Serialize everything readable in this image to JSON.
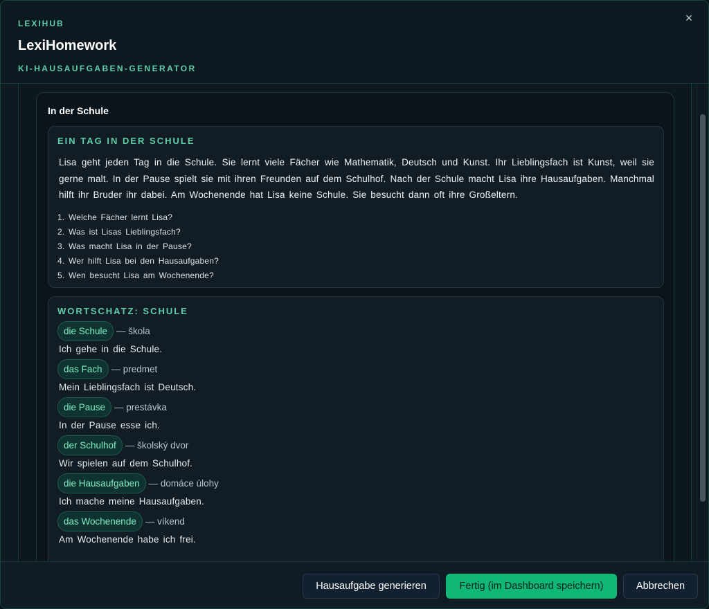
{
  "header": {
    "brand": "LEXIHUB",
    "title": "LexiHomework",
    "subtitle": "KI-HAUSAUFGABEN-GENERATOR",
    "close_label": "×"
  },
  "card": {
    "title": "In der Schule",
    "reading": {
      "heading": "EIN TAG IN DER SCHULE",
      "passage": "Lisa geht jeden Tag in die Schule. Sie lernt viele Fächer wie Mathematik, Deutsch und Kunst. Ihr Lieblingsfach ist Kunst, weil sie gerne malt. In der Pause spielt sie mit ihren Freunden auf dem Schulhof. Nach der Schule macht Lisa ihre Hausaufgaben. Manchmal hilft ihr Bruder ihr dabei. Am Wochenende hat Lisa keine Schule. Sie besucht dann oft ihre Großeltern.",
      "questions": [
        "1. Welche Fächer lernt Lisa?",
        "2. Was ist Lisas Lieblingsfach?",
        "3. Was macht Lisa in der Pause?",
        "4. Wer hilft Lisa bei den Hausaufgaben?",
        "5. Wen besucht Lisa am Wochenende?"
      ]
    },
    "vocab": {
      "heading": "WORTSCHATZ: SCHULE",
      "items": [
        {
          "term": "die Schule",
          "translation": "— škola",
          "example": "Ich gehe in die Schule."
        },
        {
          "term": "das Fach",
          "translation": "— predmet",
          "example": "Mein Lieblingsfach ist Deutsch."
        },
        {
          "term": "die Pause",
          "translation": "— prestávka",
          "example": "In der Pause esse ich."
        },
        {
          "term": "der Schulhof",
          "translation": "— školský dvor",
          "example": "Wir spielen auf dem Schulhof."
        },
        {
          "term": "die Hausaufgaben",
          "translation": "— domáce úlohy",
          "example": "Ich mache meine Hausaufgaben."
        },
        {
          "term": "das Wochenende",
          "translation": "— víkend",
          "example": "Am Wochenende habe ich frei."
        }
      ]
    }
  },
  "footer": {
    "generate_label": "Hausaufgabe generieren",
    "done_label": "Fertig (im Dashboard speichern)",
    "cancel_label": "Abbrechen"
  },
  "colors": {
    "accent": "#5fcfa9",
    "primary_button": "#10b878",
    "pill_bg": "#0f3330",
    "pill_text": "#7ef0c4"
  }
}
